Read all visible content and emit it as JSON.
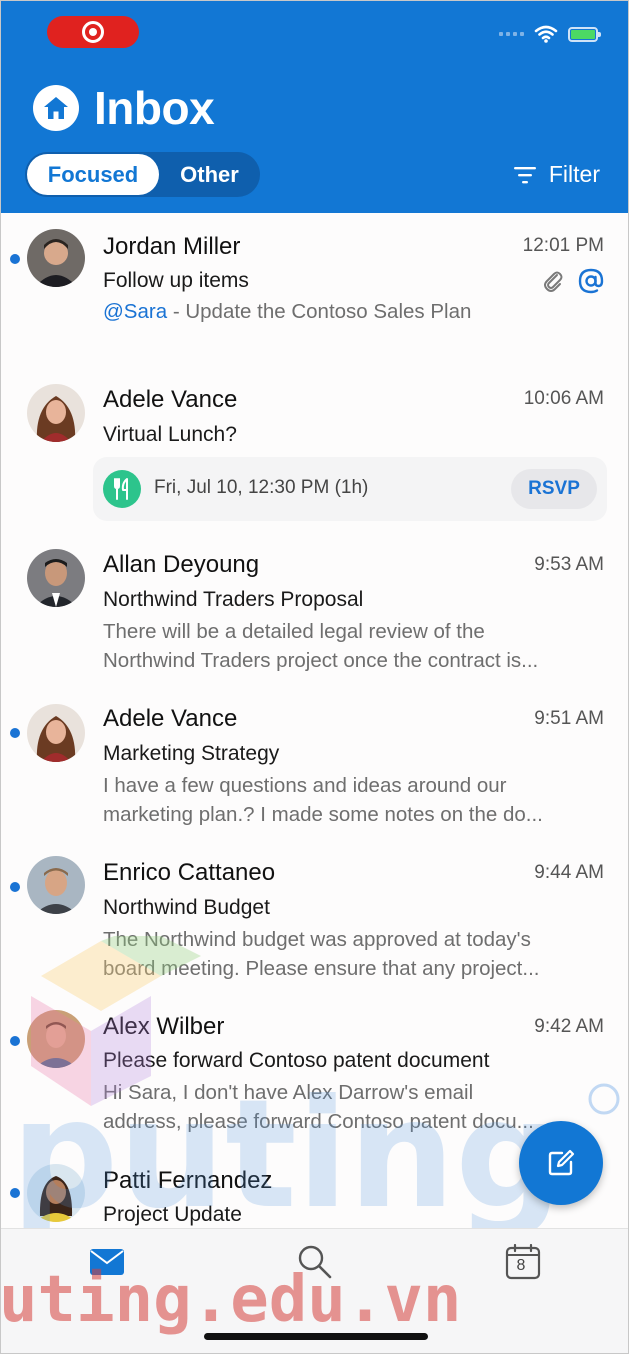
{
  "status_bar": {
    "recording": true
  },
  "header": {
    "title": "Inbox",
    "tabs": [
      {
        "label": "Focused",
        "active": true
      },
      {
        "label": "Other",
        "active": false
      }
    ],
    "filter_label": "Filter"
  },
  "messages": [
    {
      "sender": "Jordan Miller",
      "time": "12:01 PM",
      "subject": "Follow up items",
      "mention": "@Sara",
      "preview": " - Update the Contoso Sales Plan",
      "unread": true,
      "has_attachment": true,
      "has_mention": true
    },
    {
      "sender": "Adele Vance",
      "time": "10:06 AM",
      "subject": "Virtual Lunch?",
      "event": {
        "text": "Fri, Jul 10, 12:30 PM (1h)",
        "action": "RSVP"
      },
      "unread": false
    },
    {
      "sender": "Allan Deyoung",
      "time": "9:53 AM",
      "subject": "Northwind Traders Proposal",
      "preview_lines": [
        "There will be a detailed legal review of the",
        "Northwind Traders project once the contract is..."
      ],
      "unread": false
    },
    {
      "sender": "Adele Vance",
      "time": "9:51 AM",
      "subject": "Marketing Strategy",
      "preview_lines": [
        "I have a few questions and ideas around our",
        "marketing plan.? I made some notes on the do..."
      ],
      "unread": true
    },
    {
      "sender": "Enrico Cattaneo",
      "time": "9:44 AM",
      "subject": "Northwind Budget",
      "preview_lines": [
        "The Northwind budget was approved at today's",
        "board meeting. Please ensure that any project..."
      ],
      "unread": true
    },
    {
      "sender": "Alex Wilber",
      "time": "9:42 AM",
      "subject": "Please forward Contoso patent document",
      "preview_lines": [
        "Hi Sara, I don't have Alex Darrow's email",
        "address, please forward Contoso patent docu..."
      ],
      "unread": true
    },
    {
      "sender": "Patti Fernandez",
      "subject": "Project Update",
      "unread": true
    }
  ],
  "tabbar": {
    "items": [
      "mail",
      "search",
      "calendar"
    ],
    "calendar_day": "8"
  },
  "watermark": {
    "text": "uting.edu.vn"
  },
  "colors": {
    "brand": "#1277d4",
    "unread_dot": "#1a73d4",
    "event_green": "#2dc48c"
  }
}
